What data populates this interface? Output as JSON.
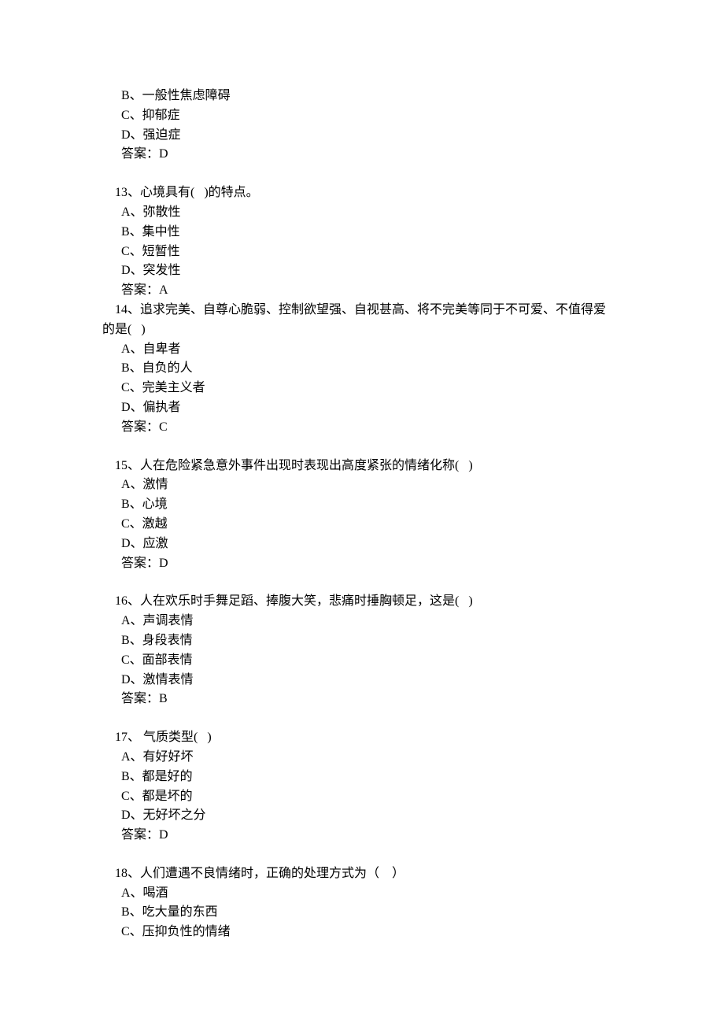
{
  "q12_tail": {
    "options": [
      "B、一般性焦虑障碍",
      "C、抑郁症",
      "D、强迫症"
    ],
    "answer": "答案：D"
  },
  "q13": {
    "question": "13、心境具有(   )的特点。",
    "options": [
      "A、弥散性",
      "B、集中性",
      "C、短暂性",
      "D、突发性"
    ],
    "answer": "答案：A"
  },
  "q14": {
    "question_line1": "14、追求完美、自尊心脆弱、控制欲望强、自视甚高、将不完美等同于不可爱、不值得爱",
    "question_line2": "的是(   )",
    "options": [
      "A、自卑者",
      "B、自负的人",
      "C、完美主义者",
      "D、偏执者"
    ],
    "answer": "答案：C"
  },
  "q15": {
    "question": "15、人在危险紧急意外事件出现时表现出高度紧张的情绪化称(   )",
    "options": [
      "A、激情",
      "B、心境",
      "C、激越",
      "D、应激"
    ],
    "answer": "答案：D"
  },
  "q16": {
    "question": "16、人在欢乐时手舞足蹈、捧腹大笑，悲痛时捶胸顿足，这是(   )",
    "options": [
      "A、声调表情",
      "B、身段表情",
      "C、面部表情",
      "D、激情表情"
    ],
    "answer": "答案：B"
  },
  "q17": {
    "question": "17、 气质类型(   )",
    "options": [
      "A、有好好坏",
      "B、都是好的",
      "C、都是坏的",
      "D、无好坏之分"
    ],
    "answer": "答案：D"
  },
  "q18": {
    "question": "18、人们遭遇不良情绪时，正确的处理方式为（　）",
    "options": [
      "A、喝酒",
      "B、吃大量的东西",
      "C、压抑负性的情绪"
    ]
  }
}
